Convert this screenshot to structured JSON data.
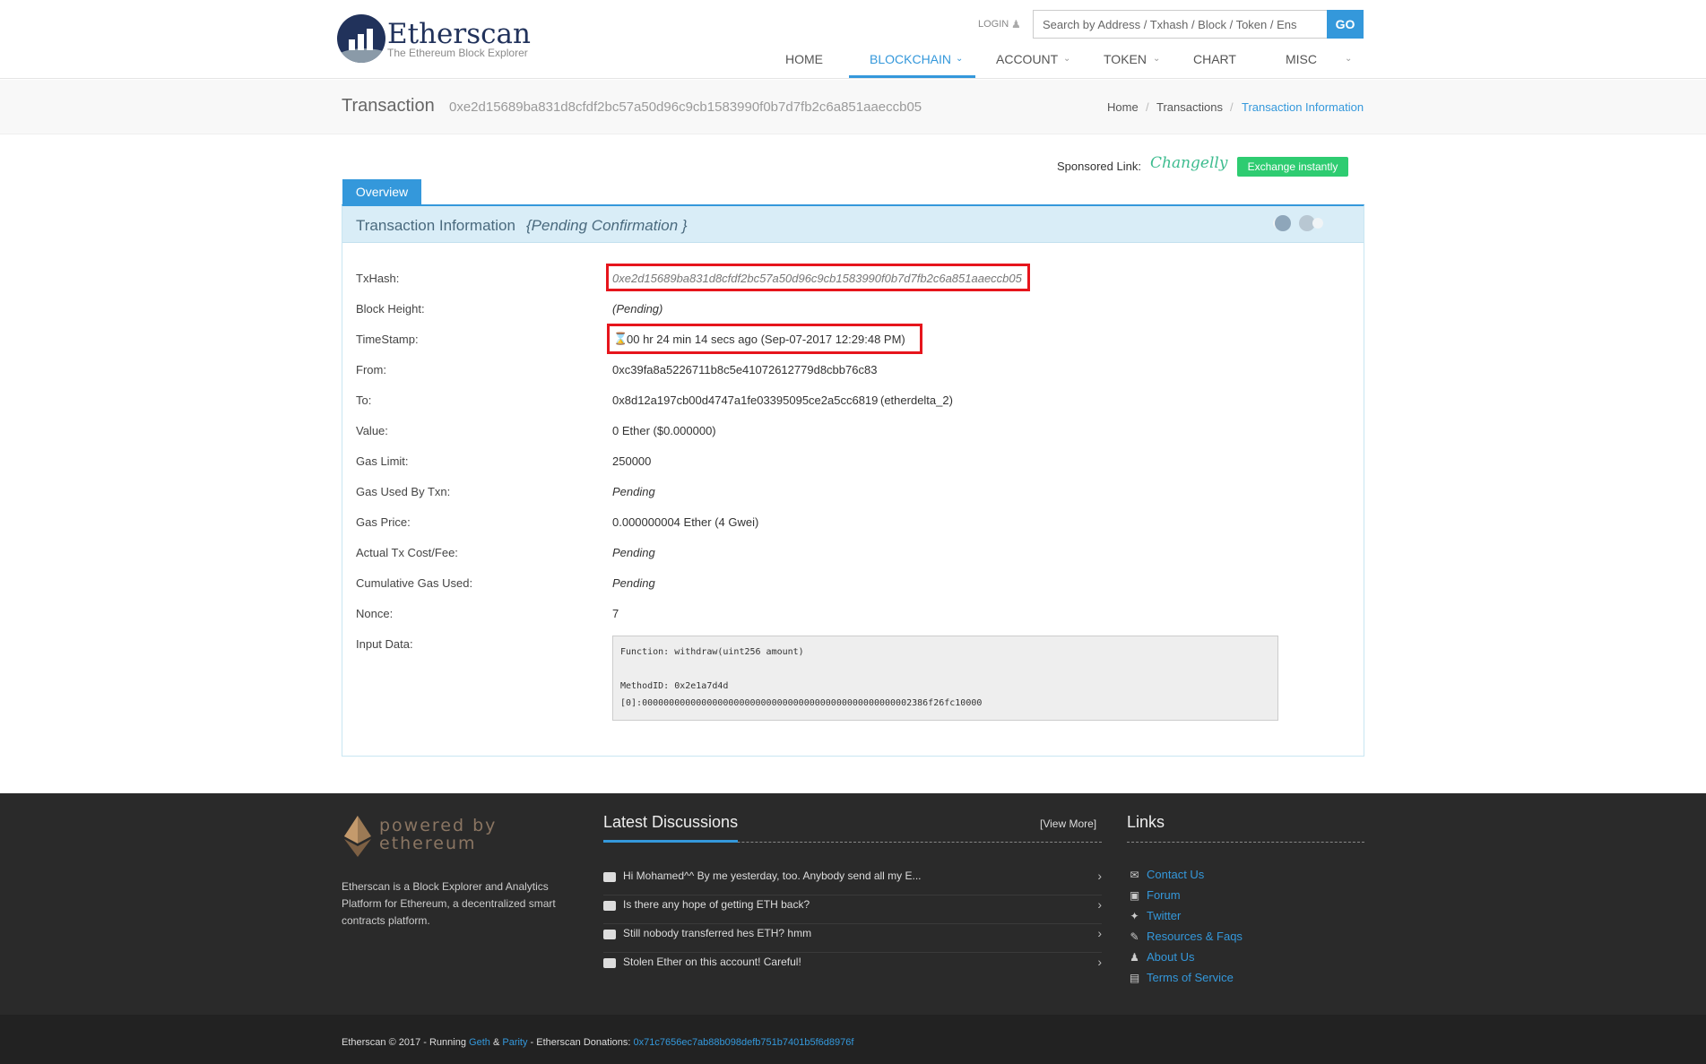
{
  "header": {
    "logo_title": "Etherscan",
    "logo_tagline": "The Ethereum Block Explorer",
    "login_label": "LOGIN",
    "search_placeholder": "Search by Address / Txhash / Block / Token / Ens",
    "go_label": "GO",
    "nav": [
      {
        "label": "HOME",
        "has_menu": false
      },
      {
        "label": "BLOCKCHAIN",
        "has_menu": true,
        "active": true
      },
      {
        "label": "ACCOUNT",
        "has_menu": true
      },
      {
        "label": "TOKEN",
        "has_menu": true
      },
      {
        "label": "CHART",
        "has_menu": false
      },
      {
        "label": "MISC",
        "has_menu": true
      }
    ]
  },
  "subheader": {
    "title": "Transaction",
    "hash": "0xe2d15689ba831d8cfdf2bc57a50d96c9cb1583990f0b7d7fb2c6a851aaeccb05",
    "breadcrumb": [
      "Home",
      "Transactions",
      "Transaction Information"
    ]
  },
  "sponsored": {
    "label": "Sponsored Link:",
    "brand": "Changelly",
    "button": "Exchange instantly"
  },
  "tabs": [
    "Overview"
  ],
  "panel": {
    "title": "Transaction Information",
    "subtitle": "{Pending Confirmation }"
  },
  "details": {
    "txhash_label": "TxHash:",
    "txhash": "0xe2d15689ba831d8cfdf2bc57a50d96c9cb1583990f0b7d7fb2c6a851aaeccb05",
    "block_height_label": "Block Height:",
    "block_height": "(Pending)",
    "timestamp_label": "TimeStamp:",
    "timestamp": "00 hr 24 min 14 secs ago (Sep-07-2017 12:29:48 PM)",
    "from_label": "From:",
    "from": "0xc39fa8a5226711b8c5e41072612779d8cbb76c83",
    "to_label": "To:",
    "to": "0x8d12a197cb00d4747a1fe03395095ce2a5cc6819",
    "to_name": "(etherdelta_2)",
    "value_label": "Value:",
    "value": "0 Ether ($0.000000)",
    "gas_limit_label": "Gas Limit:",
    "gas_limit": "250000",
    "gas_used_label": "Gas Used By Txn:",
    "gas_used": "Pending",
    "gas_price_label": "Gas Price:",
    "gas_price": "0.000000004 Ether (4 Gwei)",
    "tx_cost_label": "Actual Tx Cost/Fee:",
    "tx_cost": "Pending",
    "cumulative_gas_label": "Cumulative Gas Used:",
    "cumulative_gas": "Pending",
    "nonce_label": "Nonce:",
    "nonce": "7",
    "input_data_label": "Input Data:",
    "input_data": "Function: withdraw(uint256 amount)\n\nMethodID: 0x2e1a7d4d\n[0]:00000000000000000000000000000000000000000000000002386f26fc10000"
  },
  "footer": {
    "powered_line1": "powered by",
    "powered_line2": "ethereum",
    "about": "Etherscan is a Block Explorer and Analytics Platform for Ethereum, a decentralized smart contracts platform.",
    "discussions_heading": "Latest Discussions",
    "view_more": "[View More]",
    "discussions": [
      "Hi Mohamed^^ By me yesterday, too. Anybody send all my E...",
      "Is there any hope of getting ETH back?",
      "Still nobody transferred hes ETH? hmm",
      "Stolen Ether on this account! Careful!"
    ],
    "links_heading": "Links",
    "links": [
      {
        "label": "Contact Us",
        "icon": "envelope-icon"
      },
      {
        "label": "Forum",
        "icon": "comment-icon"
      },
      {
        "label": "Twitter",
        "icon": "twitter-icon"
      },
      {
        "label": "Resources & Faqs",
        "icon": "edit-icon"
      },
      {
        "label": "About Us",
        "icon": "users-icon"
      },
      {
        "label": "Terms of Service",
        "icon": "document-icon"
      }
    ],
    "copyright_prefix": "Etherscan © 2017 - Running",
    "geth": "Geth",
    "amp": "&",
    "parity": "Parity",
    "donations_label": "- Etherscan Donations:",
    "donations_address": "0x71c7656ec7ab88b098defb751b7401b5f6d8976f"
  },
  "colors": {
    "accent": "#3498db",
    "highlight_box": "#e6151c",
    "exchange_button": "#2ecc71",
    "footer_bg": "#2a2a2a"
  }
}
